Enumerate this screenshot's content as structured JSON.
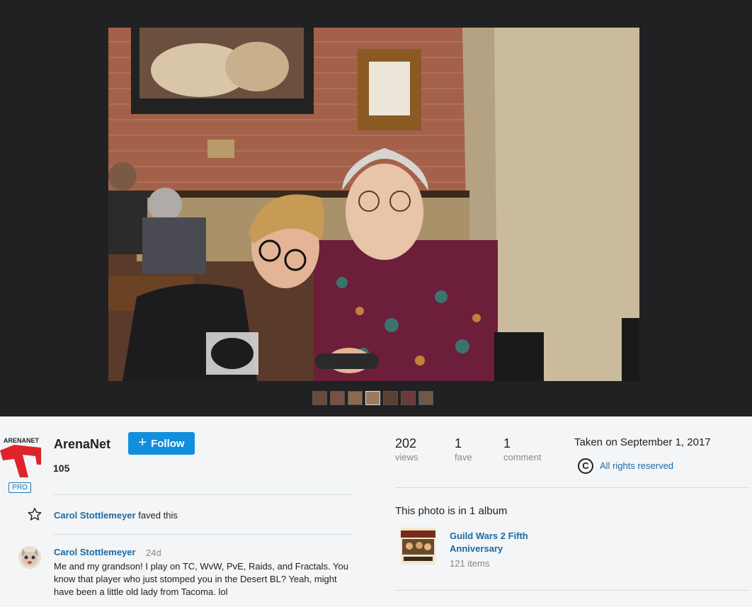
{
  "owner": {
    "name": "ArenaNet",
    "logo_text": "ARENANET",
    "badge": "PRO",
    "follow_label": "Follow",
    "count": "105"
  },
  "activity": {
    "fave": {
      "user": "Carol Stottlemeyer",
      "action": "faved this"
    },
    "comment": {
      "author": "Carol Stottlemeyer",
      "age": "24d",
      "text": "Me and my grandson! I play on TC, WvW, PvE, Raids, and Fractals. You know that player who just stomped you in the Desert BL? Yeah, might have been a little old lady from Tacoma. lol"
    }
  },
  "stats": [
    {
      "value": "202",
      "label": "views"
    },
    {
      "value": "1",
      "label": "fave"
    },
    {
      "value": "1",
      "label": "comment"
    }
  ],
  "taken": "Taken on September 1, 2017",
  "license": {
    "icon": "copyright-icon",
    "glyph": "C",
    "label": "All rights reserved"
  },
  "album": {
    "heading": "This photo is in 1 album",
    "title": "Guild Wars 2 Fifth Anniversary",
    "items": "121 items"
  },
  "filmstrip_count": 7,
  "colors": {
    "stage_bg": "#212124",
    "page_bg": "#f3f5f6",
    "link": "#1a6aa6",
    "follow_button": "#128fdc",
    "muted": "#898989",
    "brand_red": "#e0232a"
  }
}
